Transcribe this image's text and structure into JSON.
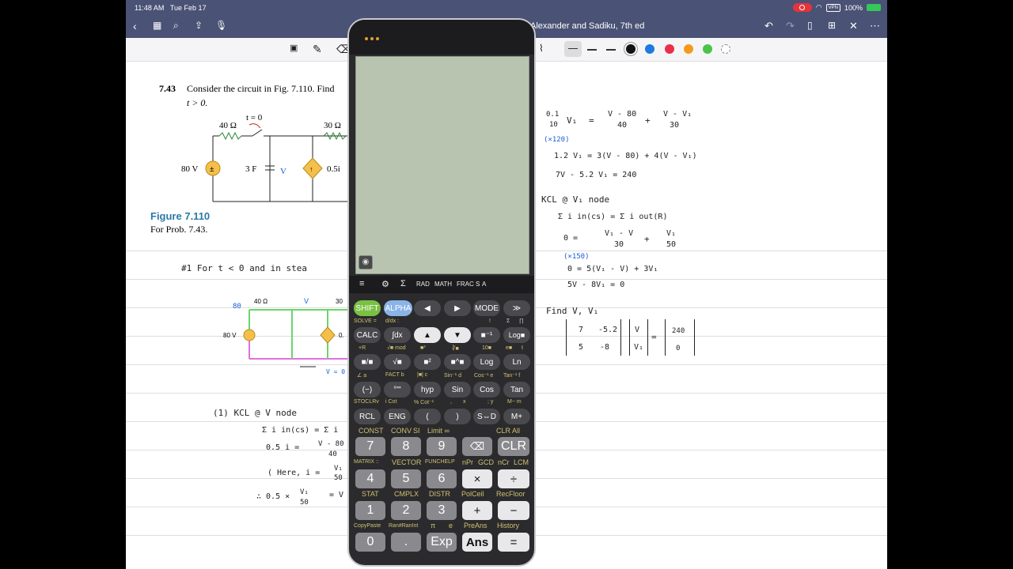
{
  "status": {
    "time": "11:48 AM",
    "date": "Tue Feb 17",
    "vpn": "VPN",
    "battery": "100%"
  },
  "document": {
    "title": "Alexander and Sadiku, 7th ed"
  },
  "textbook": {
    "problem_number": "7.43",
    "problem_text": "Consider the circuit in Fig. 7.110. Find",
    "problem_text2": "t > 0.",
    "figure_label": "Figure 7.110",
    "figure_caption": "For Prob. 7.43.",
    "circuit": {
      "source": "80 V",
      "r1": "40 Ω",
      "r2": "30 Ω",
      "switch": "t = 0",
      "cap": "3 F",
      "v": "V",
      "dep": "0.5i"
    }
  },
  "notes_left": {
    "line1": "#1  For t < 0   and  in  stea",
    "sketch_80": "80",
    "sketch_40": "40 Ω",
    "sketch_v": "V",
    "sketch_30": "30",
    "sketch_80v": "80 V",
    "sketch_0": "0.",
    "sketch_v0": "V = 0",
    "kcl": "(1)  KCL @ V node",
    "sum": "Σ i in(cs) = Σ i",
    "eq1": "0.5 i  =",
    "eq1_frac_n": "V - 80",
    "eq1_frac_d": "40",
    "here": "( Here,  i =",
    "here_n": "V₁",
    "here_d": "50",
    "eq2": "∴ 0.5 ×",
    "eq2_n": "V₁",
    "eq2_d": "50",
    "eq2_r": "= V"
  },
  "notes_right": {
    "r1_lhs_n": "0.1",
    "r1_lhs_d": "10",
    "r1_v1": "V₁",
    "r1_eq": "=",
    "r1_a_n": "V - 80",
    "r1_a_d": "40",
    "r1_plus": "+",
    "r1_b_n": "V - V₁",
    "r1_b_d": "30",
    "mult1": "(×120)",
    "r2": "1.2 V₁  =  3(V - 80) + 4(V - V₁)",
    "r3": "7V - 5.2 V₁  =  240",
    "kcl2": "KCL @ V₁ node",
    "sum2": "Σ i in(cs)  = Σ i out(R)",
    "r4_0": "0   =",
    "r4_a_n": "V₁ - V",
    "r4_a_d": "30",
    "r4_plus": "+",
    "r4_b_n": "V₁",
    "r4_b_d": "50",
    "mult2": "(×150)",
    "r5": "0  =  5(V₁ - V) + 3V₁",
    "r6": "5V - 8V₁  =  0",
    "find": "Find V, V₁",
    "m11": "7",
    "m12": "-5.2",
    "m21": "5",
    "m22": "-8",
    "vec1": "V",
    "vec2": "V₁",
    "eqsign": "=",
    "rhs1": "240",
    "rhs2": "0"
  },
  "calculator": {
    "menubar": {
      "menu": "≡",
      "gear": "⚙",
      "sigma": "Σ",
      "rad": "RAD",
      "math": "MATH",
      "frac": "FRAC",
      "s": "S",
      "a": "A"
    },
    "keys": {
      "shift": "SHIFT",
      "alpha": "ALPHA",
      "left": "◀",
      "right": "▶",
      "mode": "MODE",
      "more": "≫",
      "calc": "CALC",
      "integral": "∫dx",
      "up": "▲",
      "down": "▼",
      "inv": "■⁻¹",
      "log_b": "Log■",
      "frac": "■/■",
      "sqrt": "√■",
      "sq": "■²",
      "pow": "■^■",
      "log": "Log",
      "ln": "Ln",
      "neg": "(−)",
      "deg": "°'\"",
      "hyp": "hyp",
      "sin": "Sin",
      "cos": "Cos",
      "tan": "Tan",
      "rcl": "RCL",
      "eng": "ENG",
      "lparen": "(",
      "rparen": ")",
      "sd": "S⇔D",
      "mplus": "M+",
      "k7": "7",
      "k8": "8",
      "k9": "9",
      "del": "⌫",
      "clr": "CLR",
      "k4": "4",
      "k5": "5",
      "k6": "6",
      "mul": "×",
      "div": "÷",
      "k1": "1",
      "k2": "2",
      "k3": "3",
      "add": "+",
      "sub": "−",
      "k0": "0",
      "dot": ".",
      "exp": "Exp",
      "ans": "Ans",
      "eq": "="
    },
    "sub": {
      "solve": "SOLVE =",
      "ddx": "d/dx :",
      "r2a": "!",
      "r2b": "Σ",
      "r2c": "∏",
      "r3": "+R",
      "r3b": "√■ mod",
      "r3c": "■³",
      "r3d": "∛■",
      "r3e": "10■",
      "r3f": "e■",
      "r3g": "t",
      "r4": "∠  a",
      "r4b": "FACT b",
      "r4c": "|■| c",
      "r4d": "Sin⁻¹ d",
      "r4e": "Cos⁻¹ e",
      "r4f": "Tan⁻¹ f",
      "r5": "STOCLRv",
      "r5b": "i  Cot",
      "r5c": "% Cot⁻¹",
      "r5d": ",",
      "r5e": "x",
      "r5f": "; y",
      "r5g": "M−  m",
      "const": "CONST",
      "conv": "CONV",
      "si": "SI",
      "limit": "Limit ∞",
      "clrall": "CLR All",
      "matrix": "MATRIX ::",
      "vector": "VECTOR",
      "funchelp": "FUNCHELP",
      "npr": "nPr",
      "gcd": "GCD",
      "ncr": "nCr",
      "lcm": "LCM",
      "stat": "STAT",
      "cmplx": "CMPLX",
      "distr": "DISTR",
      "polceil": "PolCeil",
      "recfloor": "RecFloor",
      "copypaste": "CopyPaste",
      "ran": "Ran#RanInt",
      "pi": "π",
      "e": "e",
      "preans": "PreAns",
      "history": "History"
    }
  }
}
